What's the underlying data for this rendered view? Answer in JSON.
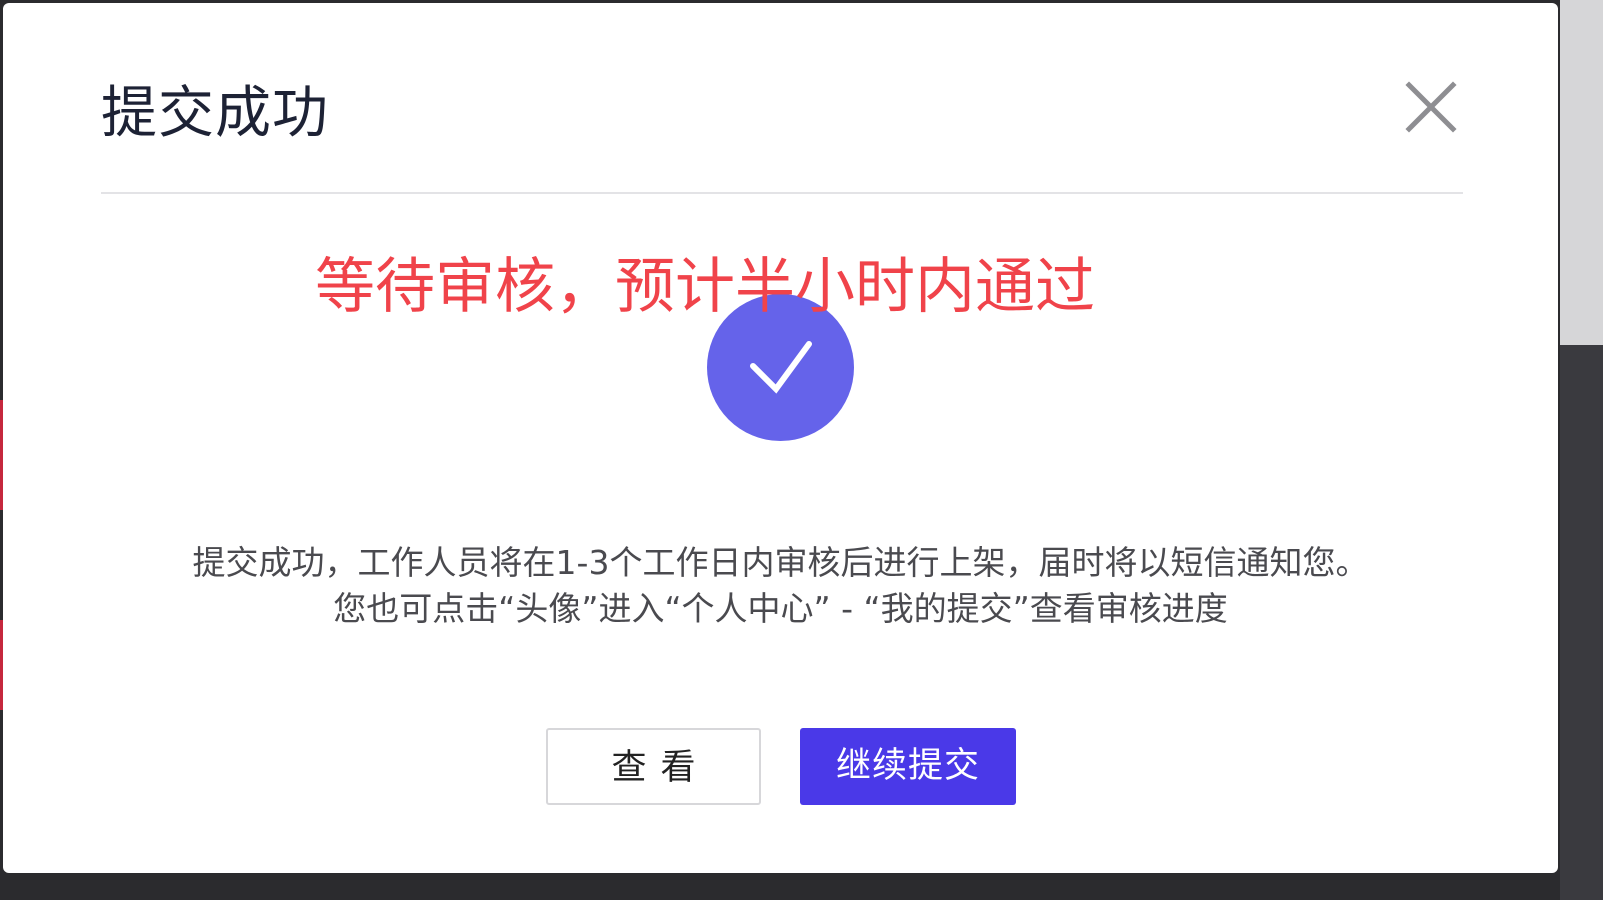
{
  "dialog": {
    "title": "提交成功",
    "close_icon": "close-icon",
    "notice": "等待审核，预计半小时内通过",
    "success_icon": "check-icon",
    "accent_color": "#6563EA",
    "notice_color": "#F0434A",
    "description": {
      "line1": "提交成功，工作人员将在1-3个工作日内审核后进行上架，届时将以短信通知您。",
      "line2": "您也可点击“头像”进入“个人中心” - “我的提交”查看审核进度"
    },
    "buttons": {
      "view_label": "查看",
      "continue_label": "继续提交",
      "continue_color": "#4A39E8"
    }
  }
}
